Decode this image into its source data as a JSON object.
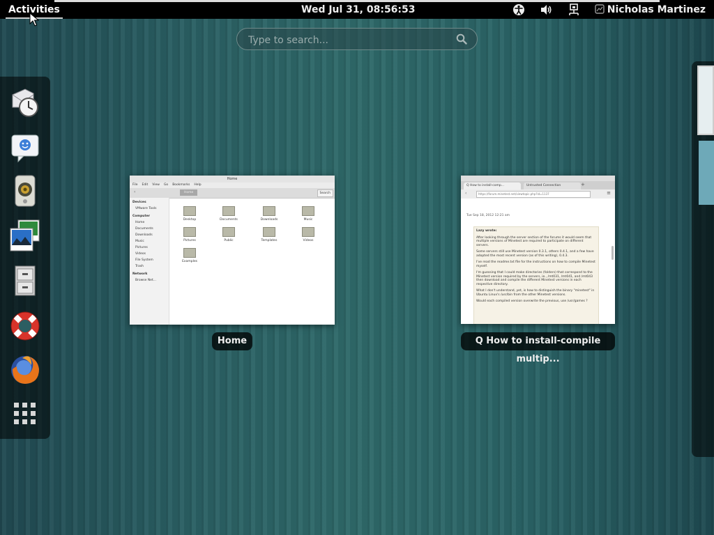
{
  "topbar": {
    "activities_label": "Activities",
    "clock": "Wed Jul 31, 08:56:53",
    "tray_icons": [
      "accessibility-icon",
      "volume-icon",
      "network-icon"
    ],
    "user_name": "Nicholas Martinez"
  },
  "search": {
    "placeholder": "Type to search..."
  },
  "dash": {
    "apps": [
      "evolution-mail-calendar-icon",
      "empathy-chat-icon",
      "rhythmbox-speaker-icon",
      "shotwell-photos-icon",
      "file-cabinet-icon",
      "help-lifebuoy-icon",
      "firefox-icon"
    ],
    "show_apps_icon": "app-grid-icon"
  },
  "windows": [
    {
      "label": "Home",
      "thumbnail": {
        "title": "Home",
        "menu": [
          "File",
          "Edit",
          "View",
          "Go",
          "Bookmarks",
          "Help"
        ],
        "search_label": "Search",
        "location_label": "Home",
        "sidebar": {
          "devices_header": "Devices",
          "devices": [
            "VMware Tools"
          ],
          "computer_header": "Computer",
          "computer": [
            "Home",
            "Documents",
            "Downloads",
            "Music",
            "Pictures",
            "Videos",
            "File System",
            "Trash"
          ],
          "network_header": "Network",
          "network": [
            "Browse Net..."
          ]
        },
        "folders": [
          "Desktop",
          "Documents",
          "Downloads",
          "Music",
          "Pictures",
          "Public",
          "Templates",
          "Videos",
          "Examples"
        ]
      }
    },
    {
      "label": "Q How to install-compile multip...",
      "thumbnail": {
        "tabs": [
          "Q How to install-comp...",
          "Untrusted Connection"
        ],
        "url": "https://forum.minetest.net/viewtopic.php?id=1137",
        "timestamp": "Tue Sep 18, 2012 12:21 am",
        "post_author": "Lazy wrote:",
        "paragraphs": [
          "After looking through the server section of the forums it would seem that multiple versions of Minetest are required to participate on different servers.",
          "Some servers still use Minetest version 0.3.1, others 0.4.1, and a few have adopted the most recent version (as of this writing), 0.4.3.",
          "I've read the readme.txt file for the instructions on how to compile Minetest myself.",
          "I'm guessing that I could make directories (folders) that correspond to the Minetest version required by the servers, ie., /mt031, /mt041, and /mt043 then download and compile the different Minetest versions in each respective directory.",
          "What I don't understand, yet, is how to distinguish the binary \"minetest\" in Ubuntu Linux's /usr/bin from the other Minetest versions.",
          "Would each compiled version overwrite the previous, use /usr/games ?"
        ]
      }
    }
  ],
  "workspaces": {
    "count": 2,
    "active": 1
  }
}
